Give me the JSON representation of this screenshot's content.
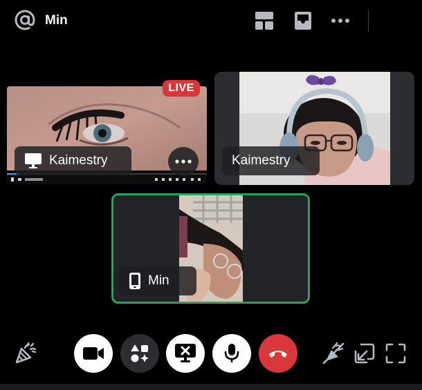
{
  "header": {
    "title": "Min",
    "icons": [
      "at-icon",
      "grid-layout-icon",
      "inbox-icon",
      "more-icon"
    ]
  },
  "tiles": {
    "stream": {
      "label": "Kaimestry",
      "badge": "LIVE",
      "icon": "monitor-icon"
    },
    "camera": {
      "label": "Kaimestry"
    },
    "self": {
      "label": "Min",
      "icon": "phone-icon",
      "speaking": true
    }
  },
  "controls": {
    "left": "party-popper-icon",
    "center": [
      "camera-icon",
      "activities-icon",
      "stop-screenshare-icon",
      "microphone-icon",
      "hang-up-icon"
    ],
    "right": [
      "noise-suppression-off-icon",
      "picture-in-picture-icon",
      "fullscreen-icon"
    ]
  },
  "colors": {
    "background": "#000000",
    "tile": "#1e1f22",
    "live": "#da373c",
    "speaking_border": "#23a55a",
    "hangup": "#da373c"
  }
}
